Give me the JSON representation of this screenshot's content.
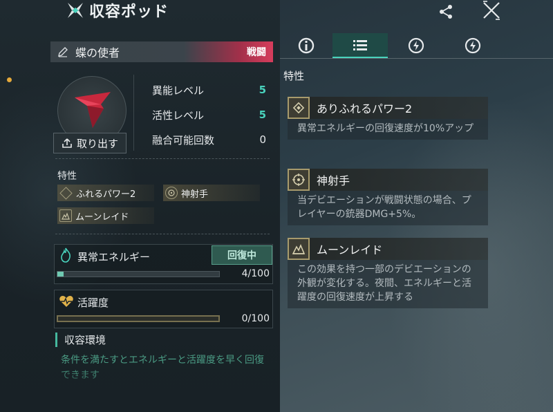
{
  "header": {
    "title": "収容ポッド"
  },
  "pod": {
    "name": "蝶の使者",
    "tag": "戦闘",
    "extract_label": "取り出す",
    "stats": [
      {
        "label": "異能レベル",
        "value": "5"
      },
      {
        "label": "活性レベル",
        "value": "5"
      },
      {
        "label": "融合可能回数",
        "value": "0"
      }
    ],
    "traits_heading": "特性",
    "traits": [
      "ふれるパワー2",
      "神射手",
      "ムーンレイド"
    ]
  },
  "energy": {
    "label": "異常エネルギー",
    "status_button": "回復中",
    "value_text": "4/100",
    "fraction": 0.04
  },
  "activity": {
    "label": "活躍度",
    "value_text": "0/100",
    "fraction": 0.0
  },
  "environment": {
    "heading": "収容環境",
    "text": "条件を満たすとエネルギーと活躍度を早く回復できます"
  },
  "detail": {
    "heading": "特性",
    "cards": [
      {
        "title": "ありふれるパワー2",
        "desc": "異常エネルギーの回復速度が10%アップ"
      },
      {
        "title": "神射手",
        "desc": "当デビエーションが戦闘状態の場合、プレイヤーの銃器DMG+5%。"
      },
      {
        "title": "ムーンレイド",
        "desc": "この効果を持つ一部のデビエーションの外観が変化する。夜間、エネルギーと活躍度の回復速度が上昇する"
      }
    ]
  },
  "colors": {
    "accent": "#49d3bd",
    "battle_tag": "#d63d5c",
    "gold": "#a89b6c"
  }
}
